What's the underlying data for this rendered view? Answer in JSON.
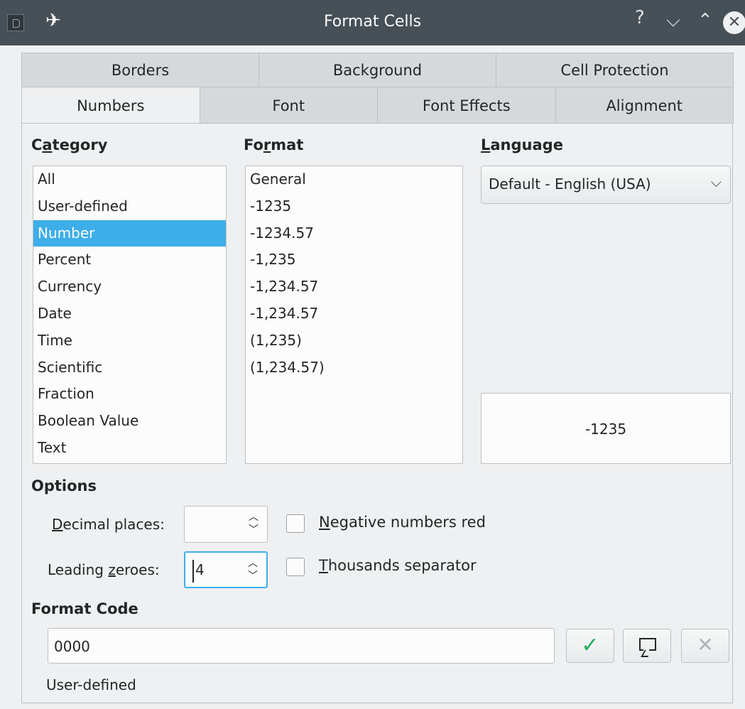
{
  "window": {
    "title": "Format Cells",
    "help": "?",
    "minimize": "⌵",
    "maximize": "⌃",
    "close": "✕"
  },
  "tabs": {
    "row1": [
      "Borders",
      "Background",
      "Cell Protection"
    ],
    "row2": [
      "Numbers",
      "Font",
      "Font Effects",
      "Alignment"
    ],
    "active": "Numbers"
  },
  "category": {
    "label_pre": "C",
    "label_u": "a",
    "label_post": "tegory",
    "items": [
      "All",
      "User-defined",
      "Number",
      "Percent",
      "Currency",
      "Date",
      "Time",
      "Scientific",
      "Fraction",
      "Boolean Value",
      "Text"
    ],
    "selected": "Number"
  },
  "format": {
    "label_pre": "Fo",
    "label_u": "r",
    "label_post": "mat",
    "items": [
      "General",
      "-1235",
      "-1234.57",
      "-1,235",
      "-1,234.57",
      "-1,234.57",
      "(1,235)",
      "(1,234.57)"
    ]
  },
  "language": {
    "label_u": "L",
    "label_post": "anguage",
    "value": "Default - English (USA)"
  },
  "preview": {
    "text": "-1235"
  },
  "options": {
    "label": "Options",
    "decimal_places": {
      "label_u": "D",
      "label_post": "ecimal places:",
      "value": ""
    },
    "leading_zeroes": {
      "label_pre": "Leading ",
      "label_u": "z",
      "label_post": "eroes:",
      "value": "4"
    },
    "negative_red": {
      "label_u": "N",
      "label_post": "egative numbers red",
      "checked": false
    },
    "thousands_sep": {
      "label_u": "T",
      "label_post": "housands separator",
      "checked": false
    }
  },
  "format_code": {
    "label": "Format Code",
    "value": "0000",
    "status": "User-defined"
  },
  "colors": {
    "accent": "#3daee9",
    "titlebar": "#475057",
    "ok_check": "#27ae60"
  }
}
